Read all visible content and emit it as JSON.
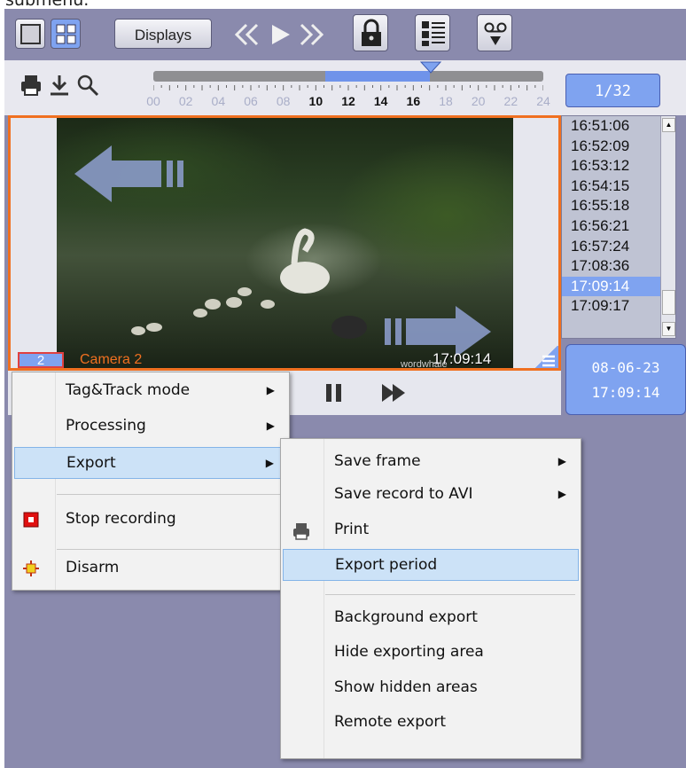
{
  "top_text": "submenu.",
  "toolbar": {
    "displays_label": "Displays",
    "icons": [
      "single-view-icon",
      "grid-view-icon",
      "rewind-icon",
      "play-icon",
      "fast-forward-icon",
      "lock-icon",
      "list-icon",
      "cassette-icon"
    ]
  },
  "timeline": {
    "hours": [
      "00",
      "02",
      "04",
      "06",
      "08",
      "10",
      "12",
      "14",
      "16",
      "18",
      "20",
      "22",
      "24"
    ],
    "active_hours": [
      "10",
      "12",
      "14",
      "16"
    ],
    "icons": [
      "print-icon",
      "download-icon",
      "search-icon"
    ]
  },
  "counter": "1/32",
  "viewer": {
    "camera_number": "2",
    "camera_name": "Camera 2",
    "timestamp": "17:09:14",
    "watermark": "wordwhale"
  },
  "timelist": {
    "items": [
      "16:51:06",
      "16:52:09",
      "16:53:12",
      "16:54:15",
      "16:55:18",
      "16:56:21",
      "16:57:24",
      "17:08:36",
      "17:09:14",
      "17:09:17"
    ],
    "selected_index": 8
  },
  "datetime": {
    "date": "08-06-23",
    "time": "17:09:14"
  },
  "context_menu": {
    "items": [
      {
        "label": "Tag&Track mode",
        "submenu": true
      },
      {
        "label": "Processing",
        "submenu": true
      },
      {
        "label": "Export",
        "submenu": true,
        "highlighted": true
      },
      {
        "label": "Stop recording",
        "icon": "stop-icon"
      },
      {
        "label": "Disarm",
        "icon": "disarm-icon"
      }
    ]
  },
  "export_submenu": {
    "items": [
      {
        "label": "Save frame",
        "submenu": true
      },
      {
        "label": "Save record to AVI",
        "submenu": true
      },
      {
        "label": "Print",
        "icon": "print-icon"
      },
      {
        "label": "Export period",
        "highlighted": true
      },
      {
        "label": "Background export"
      },
      {
        "label": "Hide exporting area"
      },
      {
        "label": "Show hidden areas"
      },
      {
        "label": "Remote export"
      }
    ]
  },
  "colors": {
    "background": "#8a8aad",
    "accent": "#7fa3f0",
    "camera_border": "#f07020",
    "menu_highlight": "#cce2f7"
  }
}
